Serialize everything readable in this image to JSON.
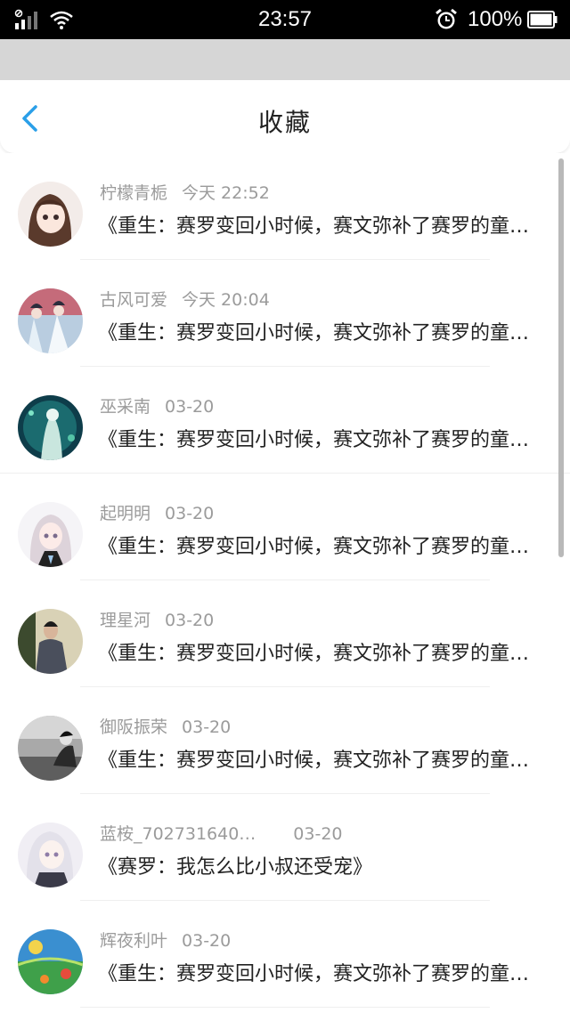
{
  "status_bar": {
    "time": "23:57",
    "battery": "100%",
    "icons": [
      "signal-icon",
      "wifi-icon",
      "alarm-icon",
      "battery-icon"
    ]
  },
  "header": {
    "title": "收藏",
    "back_icon": "chevron-left-icon",
    "accent_color": "#2a9fe8"
  },
  "items": [
    {
      "name": "柠檬青栀",
      "time": "今天 22:52",
      "title": "《重生：赛罗变回小时候，赛文弥补了赛罗的童年》"
    },
    {
      "name": "古风可爱",
      "time": "今天 20:04",
      "title": "《重生：赛罗变回小时候，赛文弥补了赛罗的童年》"
    },
    {
      "name": "巫采南",
      "time": "03-20",
      "title": "《重生：赛罗变回小时候，赛文弥补了赛罗的童年》"
    },
    {
      "name": "起明明",
      "time": "03-20",
      "title": "《重生：赛罗变回小时候，赛文弥补了赛罗的童年》"
    },
    {
      "name": "理星河",
      "time": "03-20",
      "title": "《重生：赛罗变回小时候，赛文弥补了赛罗的童年》"
    },
    {
      "name": "御阪振荣",
      "time": "03-20",
      "title": "《重生：赛罗变回小时候，赛文弥补了赛罗的童年》"
    },
    {
      "name": "蓝桉_702731640…",
      "time": "03-20",
      "title": "《赛罗：我怎么比小叔还受宠》"
    },
    {
      "name": "辉夜利叶",
      "time": "03-20",
      "title": "《重生：赛罗变回小时候，赛文弥补了赛罗的童年》"
    }
  ]
}
